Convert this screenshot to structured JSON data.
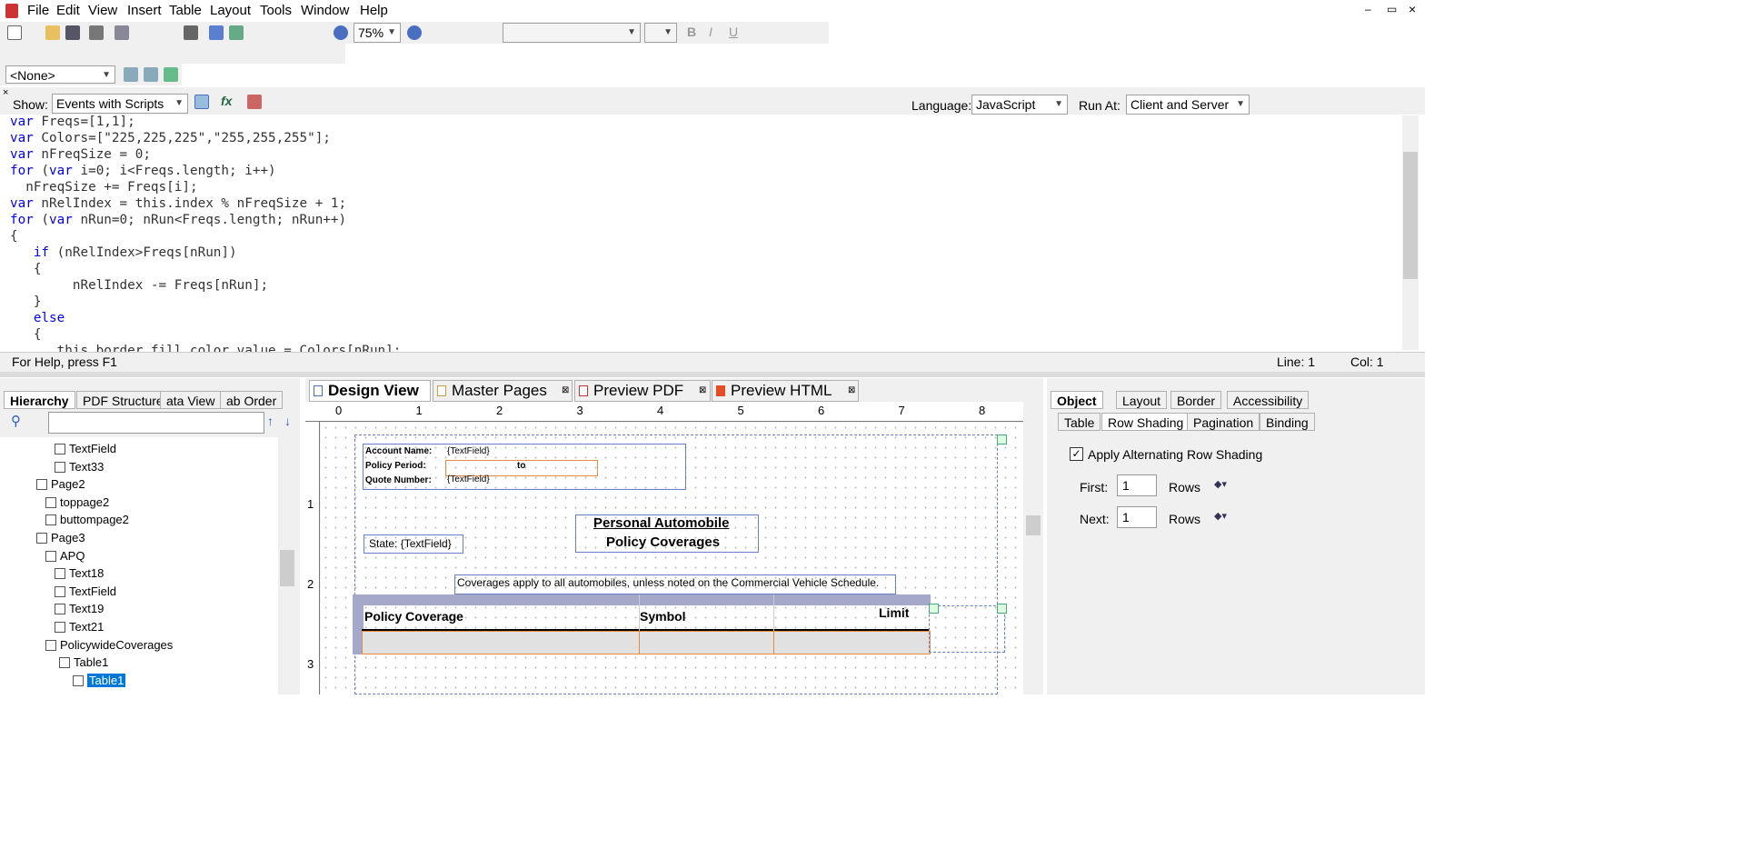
{
  "menu": [
    "File",
    "Edit",
    "View",
    "Insert",
    "Table",
    "Layout",
    "Tools",
    "Window",
    "Help"
  ],
  "window_controls": [
    "–",
    "▭",
    "×"
  ],
  "toolbar": {
    "zoom": "75%",
    "subform_select": "<None>"
  },
  "script_editor": {
    "show_label": "Show:",
    "show_value": "Events with Scripts",
    "language_label": "Language:",
    "language_value": "JavaScript",
    "runat_label": "Run At:",
    "runat_value": "Client and Server",
    "lines": [
      "var Freqs=[1,1];",
      "var Colors=[\"225,225,225\",\"255,255,255\"];",
      "var nFreqSize = 0;",
      "for (var i=0; i<Freqs.length; i++)",
      "  nFreqSize += Freqs[i];",
      "var nRelIndex = this.index % nFreqSize + 1;",
      "for (var nRun=0; nRun<Freqs.length; nRun++)",
      "{",
      "   if (nRelIndex>Freqs[nRun])",
      "   {",
      "        nRelIndex -= Freqs[nRun];",
      "   }",
      "   else",
      "   {",
      "      this.border.fill.color.value = Colors[nRun];"
    ]
  },
  "status": {
    "help": "For Help, press F1",
    "line": "Line: 1",
    "col": "Col: 1"
  },
  "left_panel": {
    "tabs": [
      "Hierarchy",
      "PDF Structure",
      "ata View",
      "ab Order"
    ],
    "tree": [
      {
        "label": "TextField",
        "indent": 60
      },
      {
        "label": "Text33",
        "indent": 60
      },
      {
        "label": "Page2",
        "indent": 40
      },
      {
        "label": "toppage2",
        "indent": 50
      },
      {
        "label": "buttompage2",
        "indent": 50
      },
      {
        "label": "Page3",
        "indent": 40
      },
      {
        "label": "APQ",
        "indent": 50
      },
      {
        "label": "Text18",
        "indent": 60
      },
      {
        "label": "TextField",
        "indent": 60
      },
      {
        "label": "Text19",
        "indent": 60
      },
      {
        "label": "Text21",
        "indent": 60
      },
      {
        "label": "PolicywideCoverages",
        "indent": 50
      },
      {
        "label": "Table1",
        "indent": 65
      },
      {
        "label": "Table1",
        "indent": 80
      }
    ]
  },
  "center": {
    "tabs": [
      "Design View",
      "Master Pages",
      "Preview PDF",
      "Preview HTML"
    ],
    "ruler": [
      "0",
      "1",
      "2",
      "3",
      "4",
      "5",
      "6",
      "7",
      "8"
    ],
    "vruler": [
      "1",
      "2",
      "3"
    ],
    "form": {
      "account_label": "Account Name:",
      "account_value": "{TextField}",
      "period_label": "Policy Period:",
      "period_to": "to",
      "quote_label": "Quote Number:",
      "quote_value": "{TextField}",
      "title1": "Personal Automobile",
      "title2": "Policy Coverages",
      "state": "State: {TextField}",
      "coverages_note": "Coverages apply to all automobiles, unless noted on the Commercial Vehicle Schedule.",
      "col1": "Policy Coverage",
      "col2": "Symbol",
      "col3": "Limit"
    }
  },
  "right_panel": {
    "tabs1": [
      "Object",
      "Layout",
      "Border",
      "Accessibility"
    ],
    "tabs2": [
      "Table",
      "Row Shading",
      "Pagination",
      "Binding"
    ],
    "apply_label": "Apply Alternating Row Shading",
    "first_label": "First:",
    "first_value": "1",
    "first_unit": "Rows",
    "next_label": "Next:",
    "next_value": "1",
    "next_unit": "Rows"
  }
}
